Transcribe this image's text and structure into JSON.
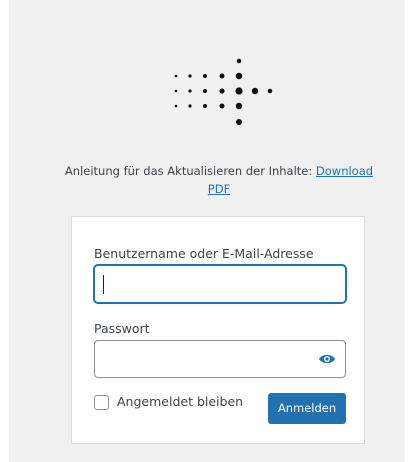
{
  "notice": {
    "text": "Anleitung für das Aktualisieren der Inhalte: ",
    "link_label": "Download PDF"
  },
  "form": {
    "username_label": "Benutzername oder E-Mail-Adresse",
    "username_value": "",
    "password_label": "Passwort",
    "password_value": "",
    "show_password_icon": "eye-icon",
    "remember_label": "Angemeldet bleiben",
    "remember_checked": false,
    "submit_label": "Anmelden"
  },
  "colors": {
    "background": "#f0f0f1",
    "accent": "#2271b1",
    "text": "#3c434a"
  }
}
